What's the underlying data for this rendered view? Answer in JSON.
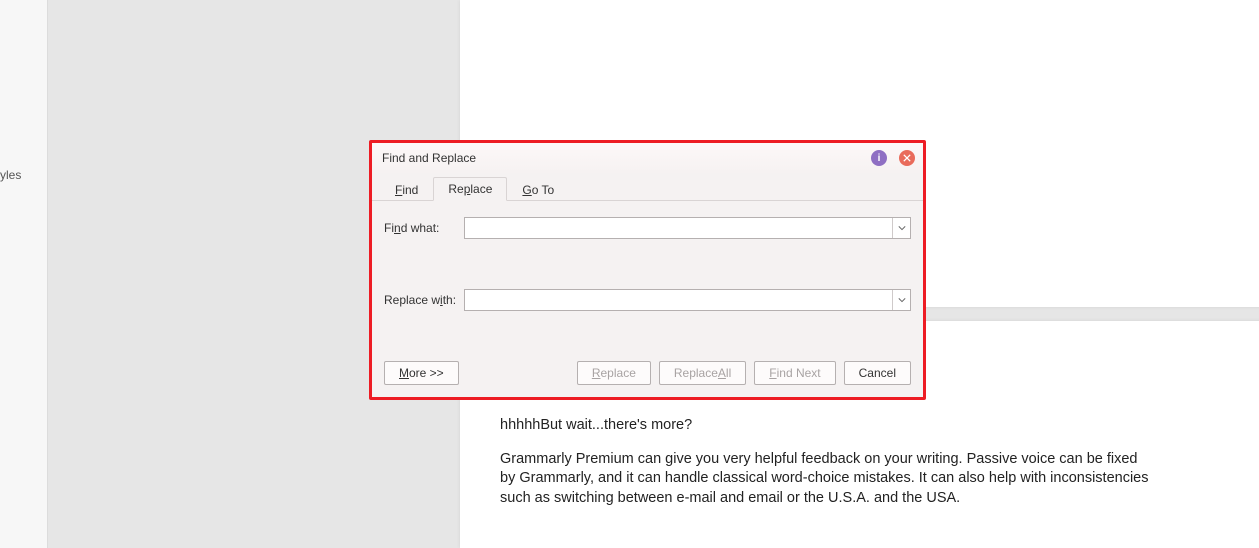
{
  "sidebar": {
    "styles_label": "yles"
  },
  "document": {
    "line1": "hhhhhBut wait...there's more?",
    "para": "Grammarly Premium can give you very helpful feedback on your writing. Passive voice can be fixed by Grammarly, and it can handle classical word-choice mistakes. It can also help with inconsistencies such as switching between e-mail and email or the U.S.A. and the USA."
  },
  "dialog": {
    "title": "Find and Replace",
    "tabs": {
      "find": "Find",
      "replace": "Replace",
      "goto": "Go To"
    },
    "labels": {
      "find_what_pre": "Fi",
      "find_what_u": "n",
      "find_what_post": "d what:",
      "replace_with_pre": "Replace w",
      "replace_with_u": "i",
      "replace_with_post": "th:"
    },
    "values": {
      "find_what": "",
      "replace_with": ""
    },
    "buttons": {
      "more_u": "M",
      "more_post": "ore >>",
      "replace_u": "R",
      "replace_post": "eplace",
      "replace_all_pre": "Replace ",
      "replace_all_u": "A",
      "replace_all_post": "ll",
      "find_next_u": "F",
      "find_next_post": "ind Next",
      "cancel": "Cancel"
    },
    "info_badge": "i"
  }
}
